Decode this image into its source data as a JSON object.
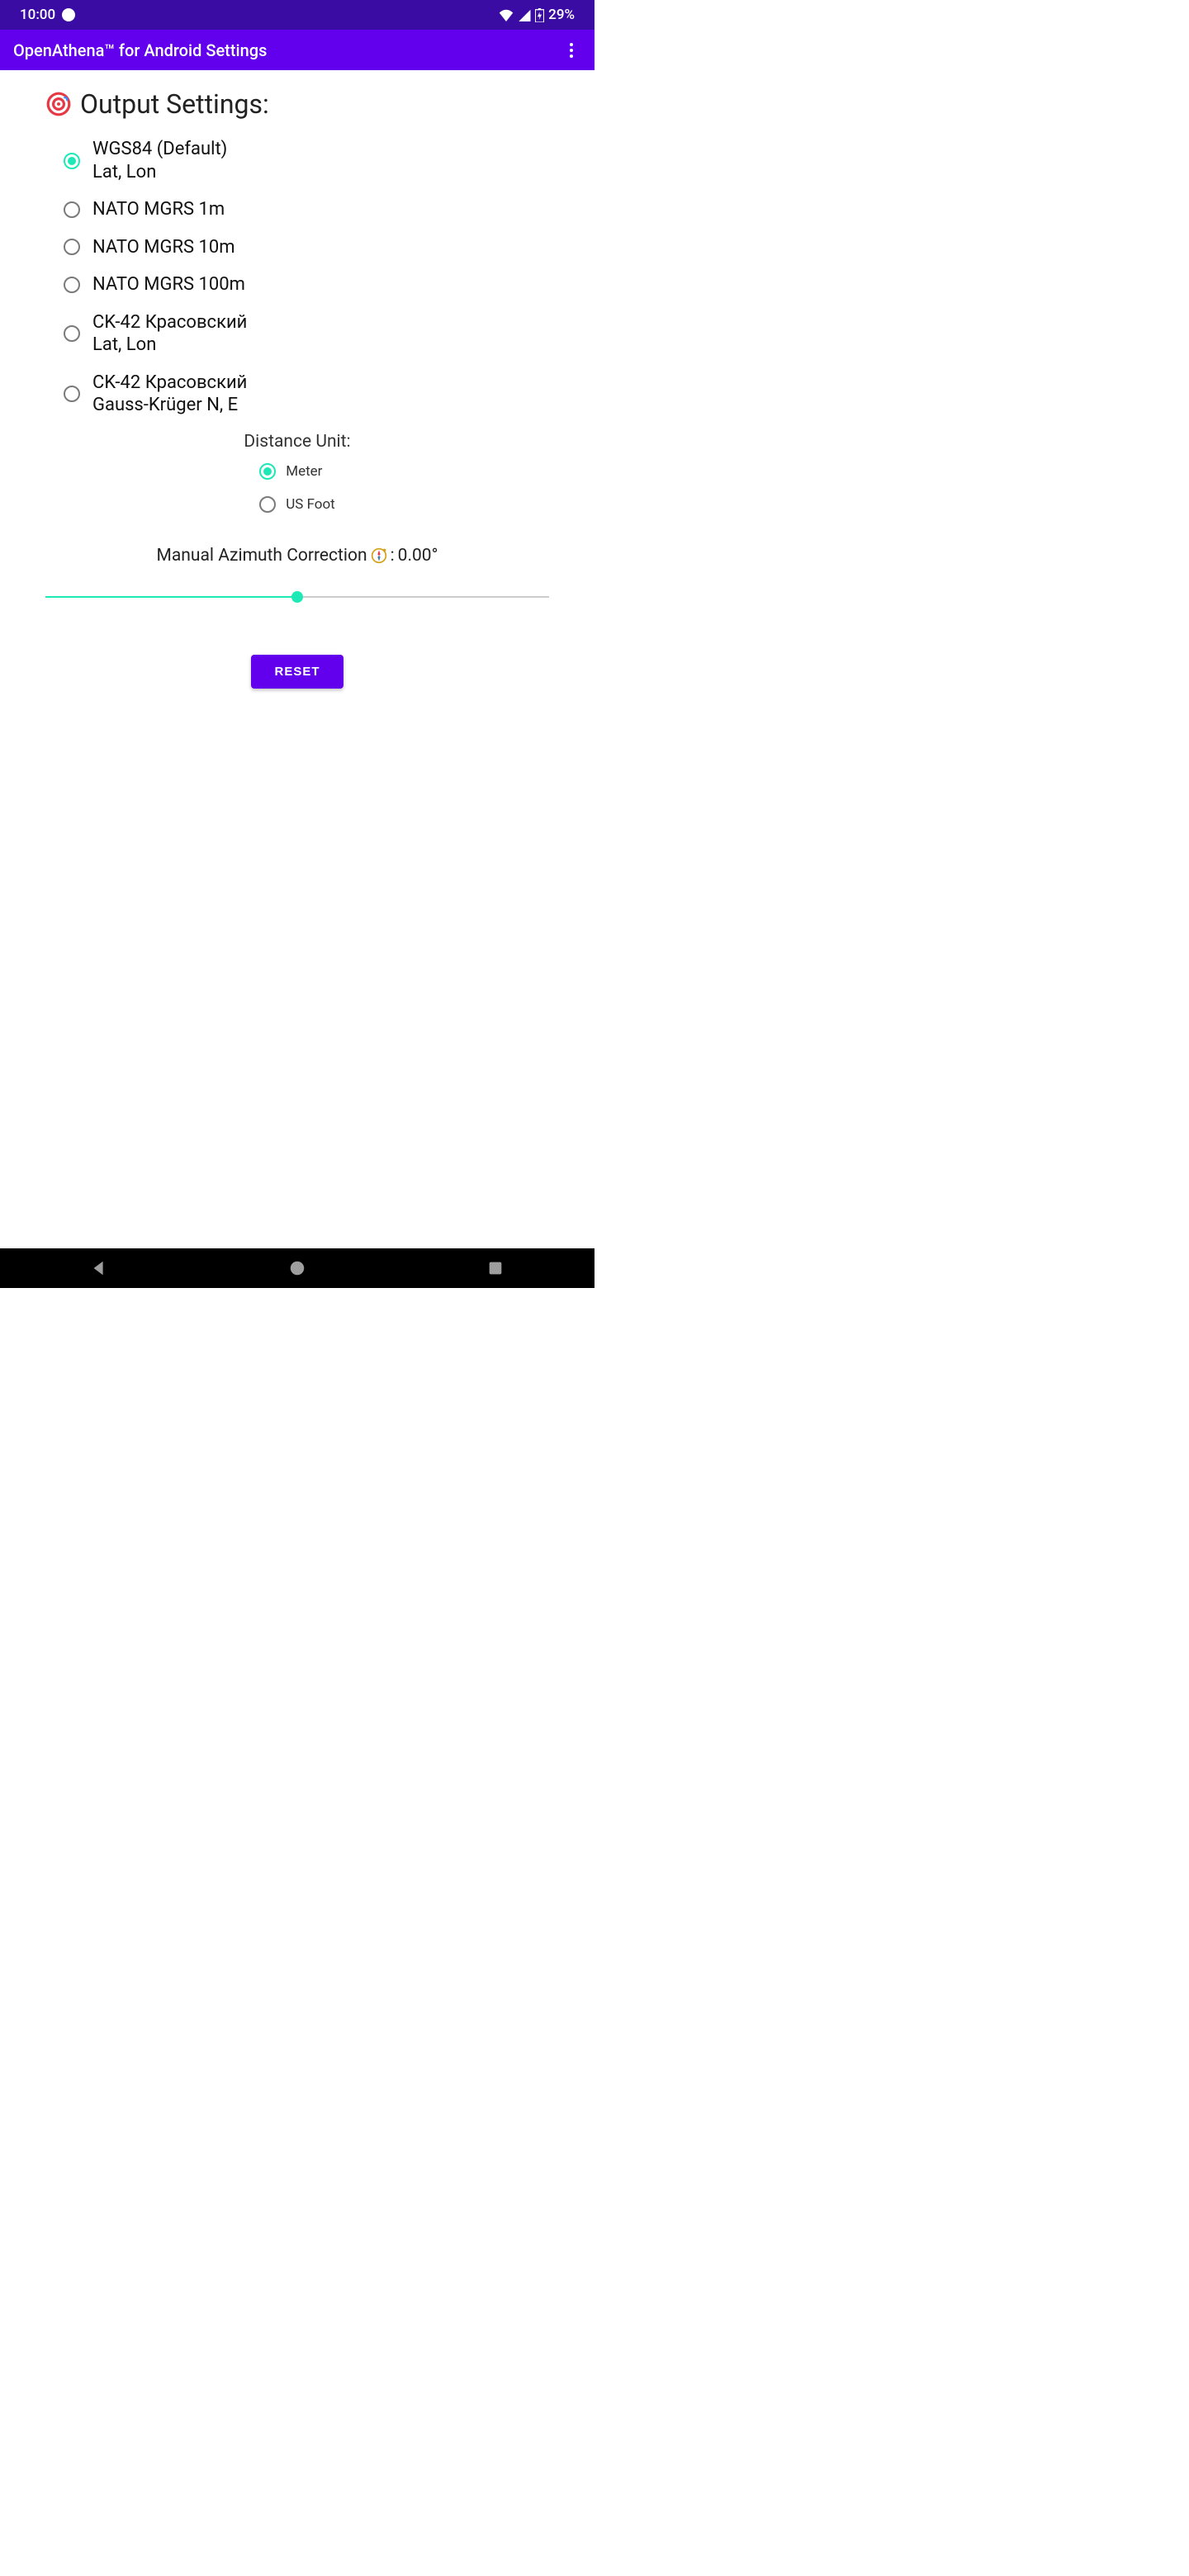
{
  "status": {
    "time": "10:00",
    "battery": "29%"
  },
  "appbar": {
    "title": "OpenAthena™ for Android Settings"
  },
  "section": {
    "title": "Output Settings:"
  },
  "output_formats": [
    {
      "label": "WGS84 (Default)\nLat, Lon",
      "checked": true
    },
    {
      "label": "NATO MGRS 1m",
      "checked": false
    },
    {
      "label": "NATO MGRS 10m",
      "checked": false
    },
    {
      "label": "NATO MGRS 100m",
      "checked": false
    },
    {
      "label": "CK-42 Красовский\nLat, Lon",
      "checked": false
    },
    {
      "label": "CK-42 Красовский\nGauss-Krüger N, E",
      "checked": false
    }
  ],
  "distance": {
    "title": "Distance Unit:",
    "options": [
      {
        "label": "Meter",
        "checked": true
      },
      {
        "label": "US Foot",
        "checked": false
      }
    ]
  },
  "azimuth": {
    "label_prefix": "Manual Azimuth Correction ",
    "value": "0.00°",
    "slider_percent": 50
  },
  "reset": {
    "label": "RESET"
  }
}
